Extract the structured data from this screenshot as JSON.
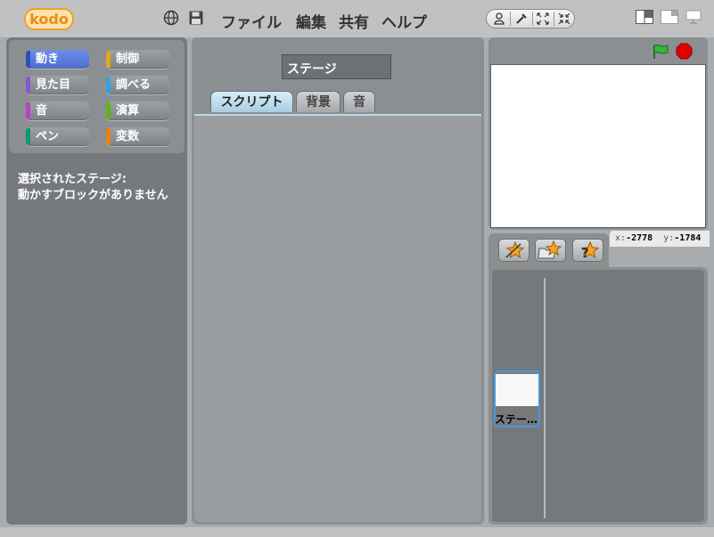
{
  "app": {
    "logo_text": "Kodo"
  },
  "menu": {
    "items": [
      "ファイル",
      "編集",
      "共有",
      "ヘルプ"
    ]
  },
  "toolbar": {
    "tools": [
      "copy-icon",
      "cut-icon",
      "grow-icon",
      "shrink-icon"
    ]
  },
  "categories": [
    {
      "label": "動き",
      "color": "#4a6cd4",
      "selected": true
    },
    {
      "label": "制御",
      "color": "#e1a91a"
    },
    {
      "label": "見た目",
      "color": "#8a55d7"
    },
    {
      "label": "調べる",
      "color": "#2ca5e2"
    },
    {
      "label": "音",
      "color": "#bb42c3"
    },
    {
      "label": "演算",
      "color": "#5cb712"
    },
    {
      "label": "ペン",
      "color": "#0e9a6c"
    },
    {
      "label": "変数",
      "color": "#ee7d16"
    }
  ],
  "blocks_panel": {
    "message_line1": "選択されたステージ:",
    "message_line2": "動かすブロックがありません"
  },
  "sprite_editor": {
    "name_value": "ステージ",
    "tabs": [
      {
        "label": "スクリプト",
        "active": true
      },
      {
        "label": "背景",
        "active": false
      },
      {
        "label": "音",
        "active": false
      }
    ]
  },
  "stage": {
    "x_label": "x:",
    "x_value": "-2778",
    "y_label": "y:",
    "y_value": "-1784"
  },
  "sprite_list": {
    "stage_thumb_label": "ステー…"
  }
}
